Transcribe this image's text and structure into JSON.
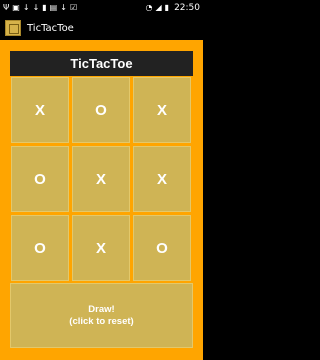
{
  "status_bar": {
    "time": "22:50",
    "icons": [
      "usb-icon",
      "image-icon",
      "download-icon",
      "download-icon",
      "notification-icon",
      "briefcase-icon",
      "download-icon",
      "checkbox-icon",
      "wifi-icon",
      "signal-icon",
      "battery-icon"
    ]
  },
  "app": {
    "title": "TicTacToe"
  },
  "game": {
    "title": "TicTacToe",
    "board": [
      [
        "X",
        "O",
        "X"
      ],
      [
        "O",
        "X",
        "X"
      ],
      [
        "O",
        "X",
        "O"
      ]
    ],
    "status_line1": "Draw!",
    "status_line2": "(click to reset)"
  },
  "colors": {
    "background": "#ffa500",
    "cell": "#cfb455",
    "title_bar": "#222222",
    "text": "#ffffff"
  }
}
